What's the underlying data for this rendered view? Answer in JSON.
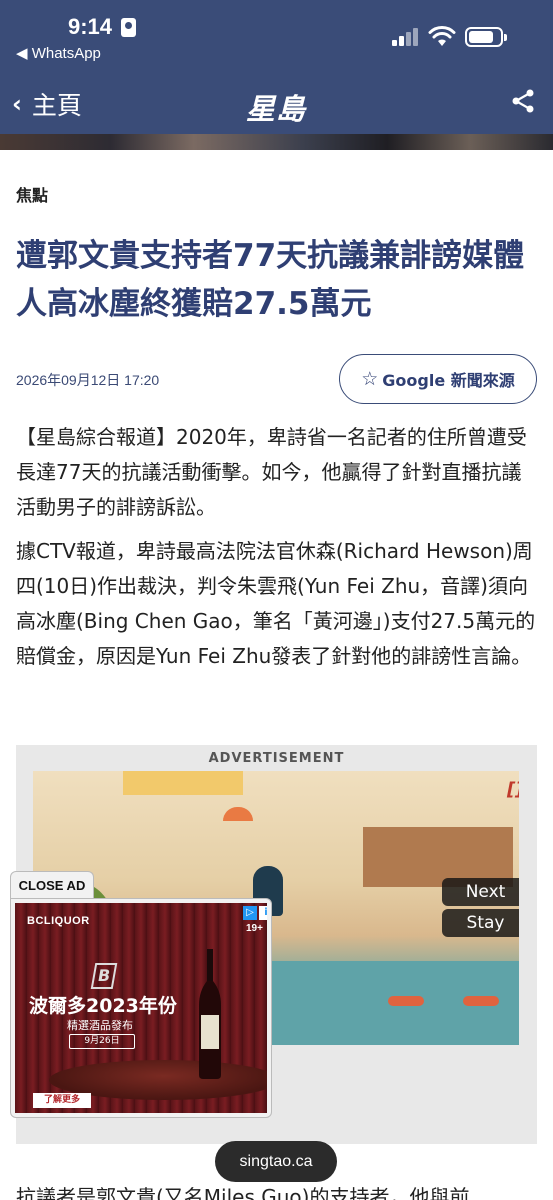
{
  "status_bar": {
    "time": "9:14",
    "back_app": "◀ WhatsApp"
  },
  "nav": {
    "back_label": "主頁",
    "logo": "星島",
    "share_icon": "share-icon"
  },
  "article": {
    "category": "焦點",
    "title": "遭郭文貴支持者77天抗議兼誹謗媒體人高冰塵終獲賠27.5萬元",
    "date": "2026年09月12日 17:20",
    "google_button": "Google 新聞來源",
    "paragraphs": [
      "【星島綜合報道】2020年，卑詩省一名記者的住所曾遭受長達77天的抗議活動衝擊。如今，他贏得了針對直播抗議活動男子的誹謗訴訟。",
      "據CTV報道，卑詩最高法院法官休森(Richard Hewson)周四(10日)作出裁決，判令朱雲飛(Yun Fei Zhu，音譯)須向高冰塵(Bing Chen Gao，筆名「黃河邊」)支付27.5萬元的賠償金，原因是Yun Fei Zhu發表了針對他的誹謗性言論。",
      "抗議者是郭文貴(又名Miles Guo)的支持者，他與前"
    ]
  },
  "ad": {
    "label": "ADVERTISEMENT",
    "marker": "[]",
    "next_label": "Next",
    "stay_label": "Stay"
  },
  "floating_ad": {
    "close_label": "CLOSE AD",
    "brand": "BCLIQUOR",
    "age": "19+",
    "headline": "波爾多2023年份",
    "subline": "精選酒品發布",
    "date": "9月26日",
    "cta": "了解更多",
    "adchoice_icon": "adchoices-icon"
  },
  "browser": {
    "url": "singtao.ca"
  },
  "colors": {
    "header_bg": "#3a4c78",
    "title": "#2f3f73"
  }
}
